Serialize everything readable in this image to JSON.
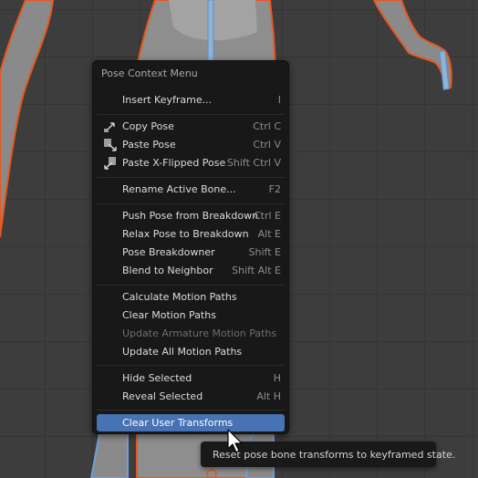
{
  "menu": {
    "title": "Pose Context Menu",
    "items": [
      {
        "label": "Insert Keyframe...",
        "shortcut": "I"
      },
      {
        "label": "Copy Pose",
        "shortcut": "Ctrl C",
        "icon": "copy-pose-icon"
      },
      {
        "label": "Paste Pose",
        "shortcut": "Ctrl V",
        "icon": "paste-pose-icon"
      },
      {
        "label": "Paste X-Flipped Pose",
        "shortcut": "Shift Ctrl V",
        "icon": "paste-flipped-pose-icon"
      },
      {
        "label": "Rename Active Bone...",
        "shortcut": "F2"
      },
      {
        "label": "Push Pose from Breakdown",
        "shortcut": "Ctrl E"
      },
      {
        "label": "Relax Pose to Breakdown",
        "shortcut": "Alt E"
      },
      {
        "label": "Pose Breakdowner",
        "shortcut": "Shift E"
      },
      {
        "label": "Blend to Neighbor",
        "shortcut": "Shift Alt E"
      },
      {
        "label": "Calculate Motion Paths",
        "shortcut": ""
      },
      {
        "label": "Clear Motion Paths",
        "shortcut": ""
      },
      {
        "label": "Update Armature Motion Paths",
        "shortcut": "",
        "disabled": true
      },
      {
        "label": "Update All Motion Paths",
        "shortcut": ""
      },
      {
        "label": "Hide Selected",
        "shortcut": "H"
      },
      {
        "label": "Reveal Selected",
        "shortcut": "Alt H"
      },
      {
        "label": "Clear User Transforms",
        "shortcut": "",
        "active": true
      }
    ]
  },
  "tooltip": {
    "text": "Reset pose bone transforms to keyframed state."
  },
  "colors": {
    "accent": "#4772b3",
    "selection_outline": "#e8571e",
    "mesh": "#9a9a9a"
  }
}
